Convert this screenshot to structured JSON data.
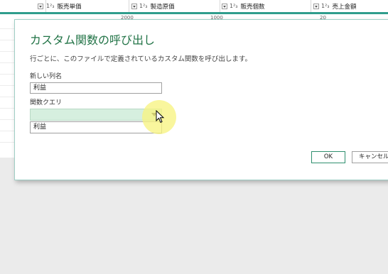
{
  "table": {
    "columns": [
      {
        "type_icon": "1²₃",
        "label": "販売単価"
      },
      {
        "type_icon": "1²₃",
        "label": "製造原価"
      },
      {
        "type_icon": "1²₃",
        "label": "販売個数"
      },
      {
        "type_icon": "1²₃",
        "label": "売上金額"
      }
    ],
    "partial_values": [
      "2000",
      "1000",
      "20"
    ]
  },
  "dialog": {
    "title": "カスタム関数の呼び出し",
    "description": "行ごとに、このファイルで定義されているカスタム関数を呼び出します。",
    "new_column_label": "新しい列名",
    "new_column_value": "利益",
    "function_query_label": "関数クエリ",
    "function_query_selected": "",
    "dropdown_options": [
      "利益"
    ],
    "ok_label": "OK",
    "cancel_label": "キャンセル"
  },
  "colors": {
    "accent": "#217346",
    "teal_bar": "#2f9d8c",
    "select_bg": "#d6efdf"
  }
}
